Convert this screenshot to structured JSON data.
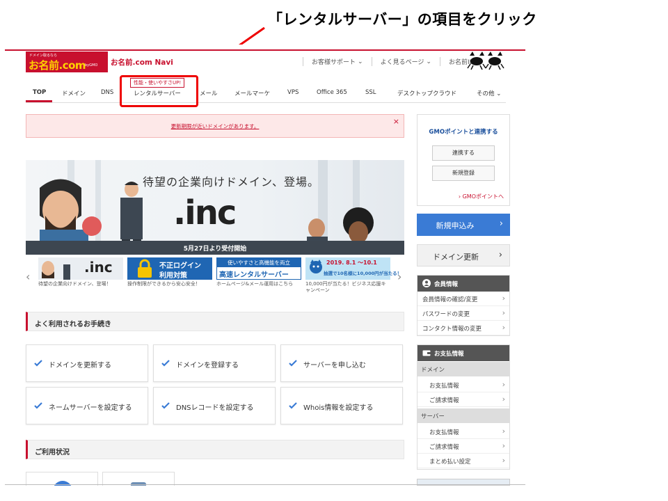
{
  "instruction": "「レンタルサーバー」の項目をクリック",
  "colors": {
    "brand_red": "#c8102e",
    "highlight_red": "#e00000",
    "primary_blue": "#3a7bd5",
    "gmo_blue": "#1a4f9c"
  },
  "header": {
    "logo_small": "ドメイン取るなら",
    "logo_main": "お名前.com",
    "logo_gmo": "byGMO",
    "navi_title": "お名前.com Navi",
    "links": [
      {
        "label": "お客様サポート",
        "icon": "chevron-down-icon"
      },
      {
        "label": "よく見るページ",
        "icon": "chevron-down-icon"
      },
      {
        "label": "お名前ID",
        "icon": "chevron-down-icon"
      }
    ]
  },
  "nav": {
    "promo_bubble": "性能・使いやすさUP!",
    "items": [
      "TOP",
      "ドメイン",
      "DNS",
      "レンタルサーバー",
      "メール",
      "メールマーケ",
      "VPS",
      "Office 365",
      "SSL",
      "デスクトップクラウド",
      "その他"
    ],
    "more_icon": "chevron-down-icon"
  },
  "alert": {
    "text": "更新期限が近いドメインがあります。",
    "close": "×"
  },
  "hero": {
    "title": "待望の企業向けドメイン、登場。",
    "tld": ".inc",
    "band": "5月27日より受付開始"
  },
  "carousel": {
    "prev": "‹",
    "next": "›",
    "items": [
      {
        "banner": ".inc",
        "caption": "待望の企業向けドメイン、登場！"
      },
      {
        "banner_line1": "不正ログイン",
        "banner_line2": "利用対策",
        "caption": "操作制限ができるから安心安全！"
      },
      {
        "banner_line1": "使いやすさと高機能を両立",
        "banner_line2": "高速レンタルサーバー",
        "caption": "ホームページ&メール運用はこちら"
      },
      {
        "banner_line1": "2019. 8.1 ～10.1",
        "banner_line2": "抽選で10名様に10,000円が当たる！",
        "caption": "10,000円が当たる！ビジネス応援キャンペーン"
      }
    ]
  },
  "procedures": {
    "heading": "よく利用されるお手続き",
    "buttons": [
      "ドメインを更新する",
      "ドメインを登録する",
      "サーバーを申し込む",
      "ネームサーバーを設定する",
      "DNSレコードを設定する",
      "Whois情報を設定する"
    ]
  },
  "usage": {
    "heading": "ご利用状況"
  },
  "sidebar": {
    "gmo": {
      "title": "GMOポイントと連携する",
      "link_btn": "連携する",
      "register_btn": "新規登録",
      "points_link": "› GMOポイントへ"
    },
    "new_order": "新規申込み",
    "domain_renew": "ドメイン更新",
    "member": {
      "heading": "会員情報",
      "items": [
        "会員情報の確認/変更",
        "パスワードの変更",
        "コンタクト情報の変更"
      ]
    },
    "payment": {
      "heading": "お支払情報",
      "domain_label": "ドメイン",
      "domain_items": [
        "お支払情報",
        "ご請求情報"
      ],
      "server_label": "サーバー",
      "server_items": [
        "お支払情報",
        "ご請求情報",
        "まとめ払い設定"
      ]
    },
    "chevron": "›"
  }
}
